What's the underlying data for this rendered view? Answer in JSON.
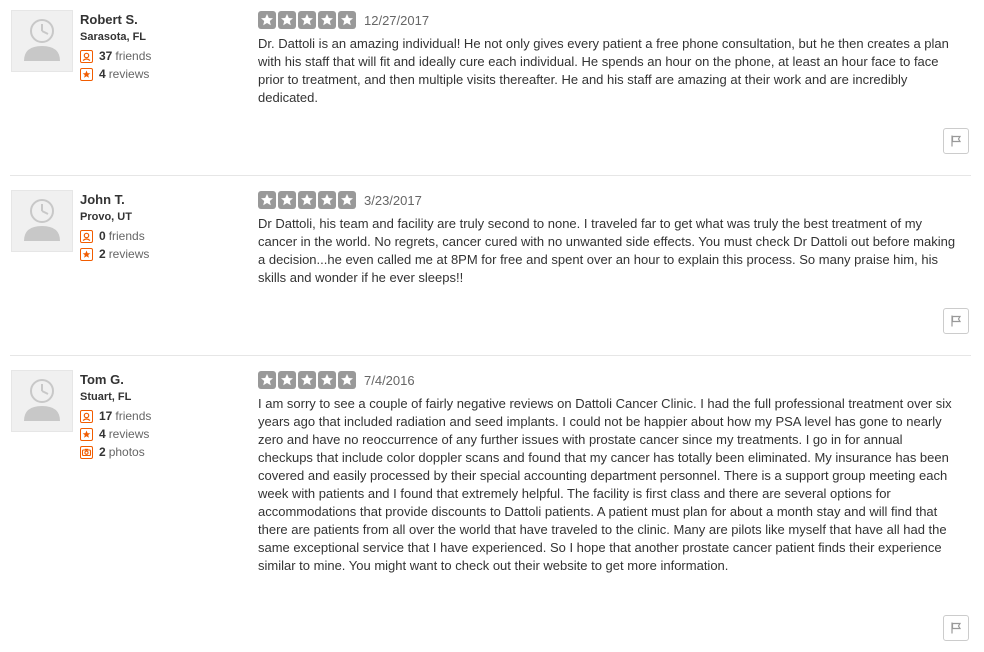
{
  "reviews": [
    {
      "user": {
        "name": "Robert S.",
        "location": "Sarasota, FL",
        "friends_count": "37",
        "friends_label": "friends",
        "reviews_count": "4",
        "reviews_label": "reviews"
      },
      "rating": 5,
      "date": "12/27/2017",
      "text": "Dr. Dattoli is an amazing individual! He not only gives every patient a free phone consultation, but he then creates a plan with his staff that will fit and ideally cure each individual. He spends an hour on the phone, at least an hour face to face prior to treatment, and then multiple visits thereafter. He and his staff are amazing at their work and are incredibly dedicated."
    },
    {
      "user": {
        "name": "John T.",
        "location": "Provo, UT",
        "friends_count": "0",
        "friends_label": "friends",
        "reviews_count": "2",
        "reviews_label": "reviews"
      },
      "rating": 5,
      "date": "3/23/2017",
      "text": "Dr Dattoli, his team and facility are truly second to none. I traveled far to get what was truly the best treatment of my cancer in the world. No regrets, cancer cured with no unwanted side effects. You must check Dr Dattoli out before making a decision...he even called me at 8PM for free and spent over an hour to explain this process. So many praise him, his skills and wonder if he ever sleeps!!"
    },
    {
      "user": {
        "name": "Tom G.",
        "location": "Stuart, FL",
        "friends_count": "17",
        "friends_label": "friends",
        "reviews_count": "4",
        "reviews_label": "reviews",
        "photos_count": "2",
        "photos_label": "photos"
      },
      "rating": 5,
      "date": "7/4/2016",
      "text": "I am sorry to see a couple of fairly negative reviews on Dattoli Cancer Clinic. I had the full professional treatment over six years ago that included radiation and seed implants. I could not be happier about how my PSA level has gone to nearly zero and have no reoccurrence of any further issues with prostate cancer since my treatments. I go in for annual checkups that include color doppler scans and found that my cancer has totally been eliminated. My insurance has been covered and easily processed by their special accounting department personnel. There is a support group meeting each week with patients and I found that extremely helpful. The facility is first class and there are several options for accommodations that provide discounts to Dattoli patients. A patient must plan for about a month stay and will find that there are patients from all over the world that have traveled to the clinic. Many are pilots like myself that have all had the same exceptional service that I have experienced. So I hope that another prostate cancer patient finds their experience similar to mine. You might want to check out their website to get more information."
    }
  ],
  "icons": {
    "avatar": "default-user-icon",
    "friends": "friends-icon",
    "reviews": "review-star-icon",
    "photos": "camera-icon",
    "star": "star-icon",
    "flag": "flag-icon"
  },
  "colors": {
    "star_inactive": "#999999",
    "stat_icon_accent": "#f15c00",
    "divider": "#e6e6e6"
  }
}
